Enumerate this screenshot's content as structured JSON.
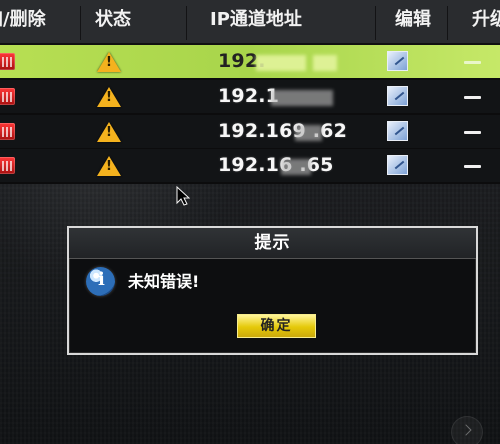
{
  "table": {
    "headers": [
      "加/删除",
      "状态",
      "IP通道地址",
      "编辑",
      "升级"
    ],
    "rows": [
      {
        "ip": "192.",
        "selected": true
      },
      {
        "ip": "192.1"
      },
      {
        "ip": "192.169  .62"
      },
      {
        "ip": "192.16   .65"
      }
    ]
  },
  "dialog": {
    "title": "提示",
    "message": "未知错误!",
    "ok_label": "确定"
  },
  "colors": {
    "selected_row": "#b6de51",
    "warning": "#f4b21e",
    "button": "#e8cf12"
  },
  "icons": [
    "delete-icon",
    "warning-icon",
    "edit-icon",
    "info-icon",
    "cursor-icon",
    "chevron-right-icon"
  ]
}
